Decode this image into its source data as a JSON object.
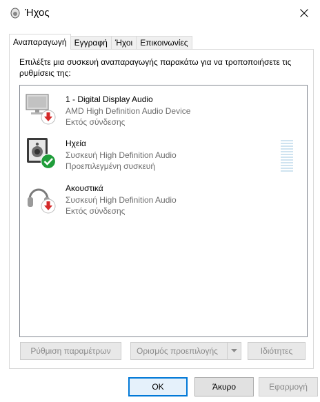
{
  "window": {
    "title": "Ήχος",
    "close_icon": "close-icon",
    "title_icon": "speaker-icon"
  },
  "tabs": [
    {
      "label": "Αναπαραγωγή",
      "active": true
    },
    {
      "label": "Εγγραφή",
      "active": false
    },
    {
      "label": "Ήχοι",
      "active": false
    },
    {
      "label": "Επικοινωνίες",
      "active": false
    }
  ],
  "playback": {
    "instruction": "Επιλέξτε μια συσκευή αναπαραγωγής παρακάτω για να τροποποιήσετε τις ρυθμίσεις της:",
    "devices": [
      {
        "name": "1 - Digital Display Audio",
        "description": "AMD High Definition Audio Device",
        "status": "Εκτός σύνδεσης",
        "icon": "monitor-icon",
        "badge": "disconnected-arrow-icon"
      },
      {
        "name": "Ηχεία",
        "description": "Συσκευή High Definition Audio",
        "status": "Προεπιλεγμένη συσκευή",
        "icon": "speakers-icon",
        "badge": "default-check-icon"
      },
      {
        "name": "Ακουστικά",
        "description": "Συσκευή High Definition Audio",
        "status": "Εκτός σύνδεσης",
        "icon": "headphones-icon",
        "badge": "disconnected-arrow-icon"
      }
    ],
    "buttons": {
      "configure": "Ρύθμιση παραμέτρων",
      "set_default": "Ορισμός προεπιλογής",
      "properties": "Ιδιότητες"
    }
  },
  "dialog_buttons": {
    "ok": "OK",
    "cancel": "Άκυρο",
    "apply": "Εφαρμογή"
  },
  "colors": {
    "accent": "#0078d7",
    "disconnected": "#d42a2a",
    "default_check": "#1f9d3a",
    "level_meter": "#cfe3f0"
  }
}
